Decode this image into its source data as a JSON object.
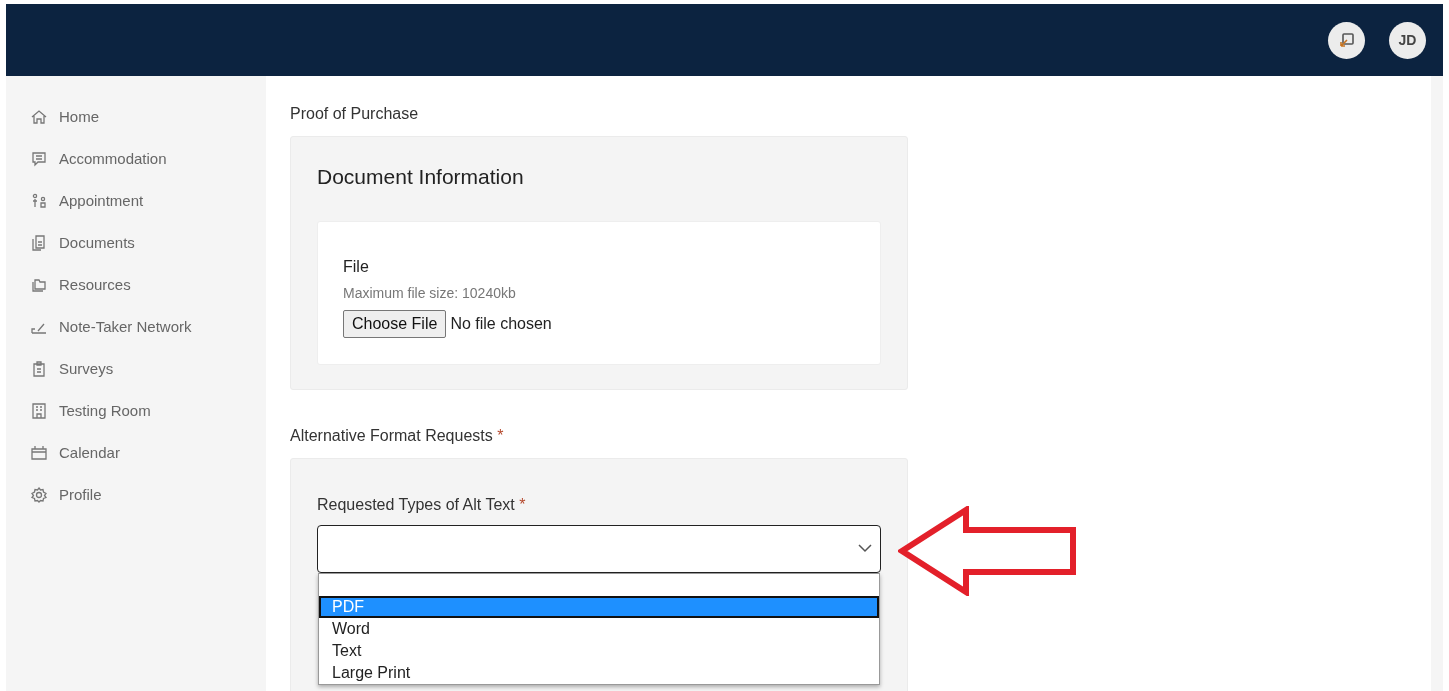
{
  "header": {
    "avatar": "JD"
  },
  "sidebar": {
    "items": [
      {
        "label": "Home"
      },
      {
        "label": "Accommodation"
      },
      {
        "label": "Appointment"
      },
      {
        "label": "Documents"
      },
      {
        "label": "Resources"
      },
      {
        "label": "Note-Taker Network"
      },
      {
        "label": "Surveys"
      },
      {
        "label": "Testing Room"
      },
      {
        "label": "Calendar"
      },
      {
        "label": "Profile"
      }
    ]
  },
  "proof_section": {
    "title": "Proof of Purchase",
    "card_title": "Document Information",
    "field_label": "File",
    "hint": "Maximum file size: 10240kb",
    "button": "Choose File",
    "status": "No file chosen"
  },
  "alt_section": {
    "title": "Alternative Format Requests",
    "required_mark": "*",
    "field_label": "Requested Types of Alt Text",
    "field_required_mark": "*",
    "options": [
      {
        "label": "PDF",
        "selected": true
      },
      {
        "label": "Word",
        "selected": false
      },
      {
        "label": "Text",
        "selected": false
      },
      {
        "label": "Large Print",
        "selected": false
      }
    ]
  }
}
